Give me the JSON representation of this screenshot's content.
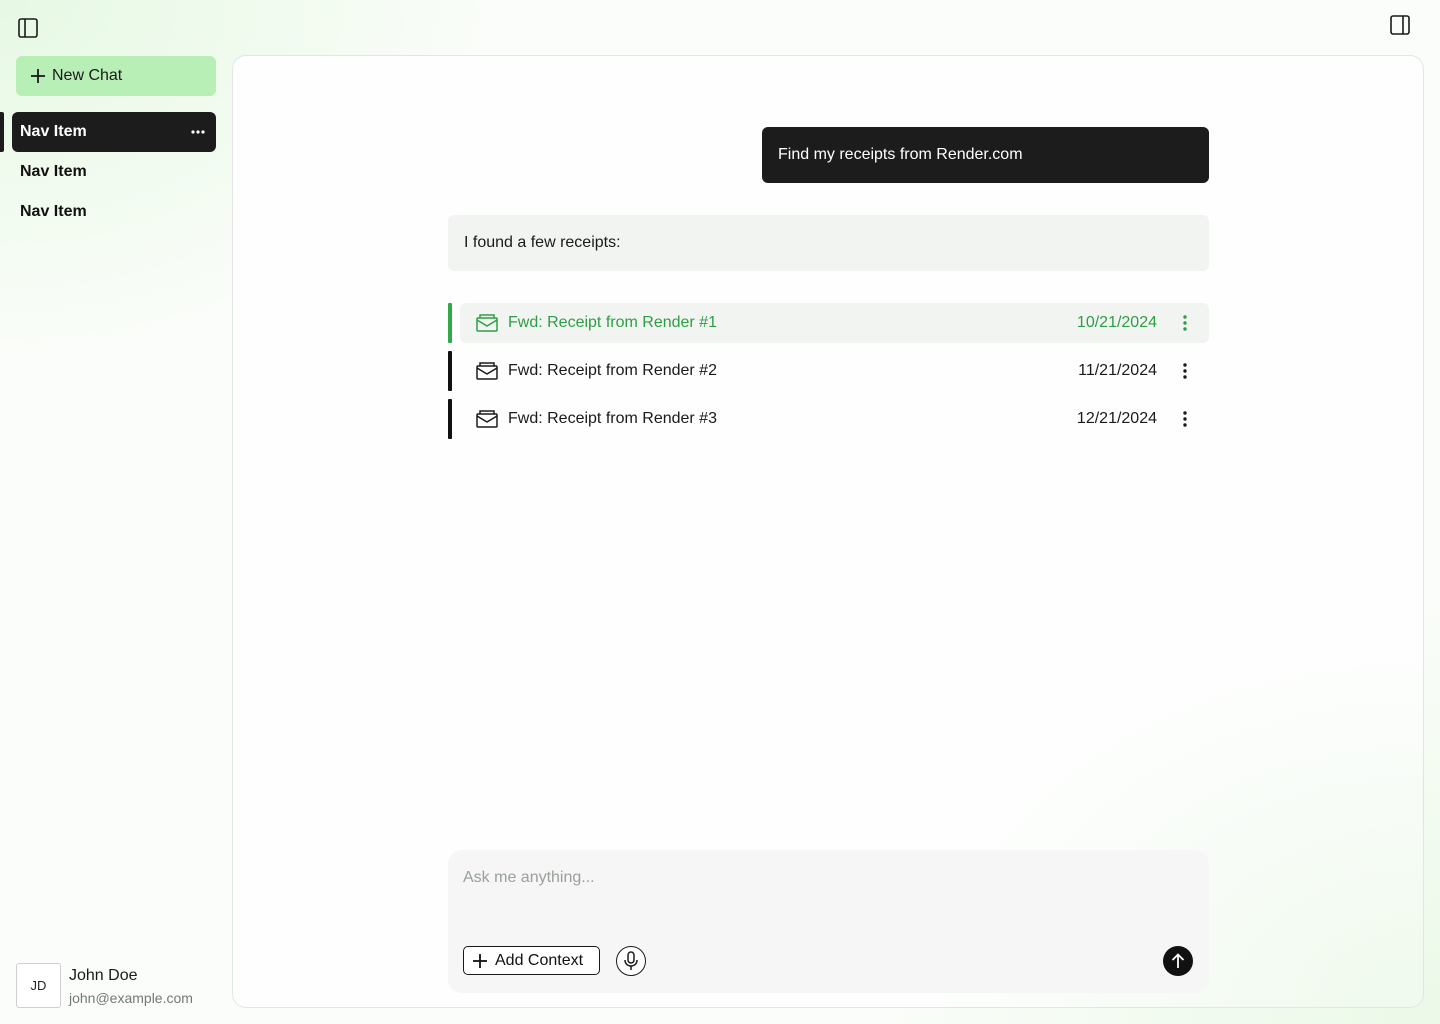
{
  "sidebar": {
    "new_chat_label": "New Chat",
    "items": [
      {
        "label": "Nav Item",
        "active": true
      },
      {
        "label": "Nav Item",
        "active": false
      },
      {
        "label": "Nav Item",
        "active": false
      }
    ],
    "user": {
      "initials": "JD",
      "name": "John Doe",
      "email": "john@example.com"
    }
  },
  "chat": {
    "user_message": "Find my receipts from Render.com",
    "assistant_message": "I found a few receipts:",
    "receipts": [
      {
        "title": "Fwd: Receipt from Render #1",
        "date": "10/21/2024",
        "selected": true
      },
      {
        "title": "Fwd: Receipt from Render #2",
        "date": "11/21/2024",
        "selected": false
      },
      {
        "title": "Fwd: Receipt from Render #3",
        "date": "12/21/2024",
        "selected": false
      }
    ]
  },
  "composer": {
    "placeholder": "Ask me anything...",
    "add_context_label": "Add Context"
  },
  "icons": {
    "left_toggle": "sidebar-left-icon",
    "right_toggle": "sidebar-right-icon",
    "mail": "mail-icon",
    "more": "more-vertical-icon",
    "mic": "microphone-icon",
    "send": "arrow-up-icon"
  },
  "colors": {
    "accent_green": "#2e9e45",
    "new_chat_bg": "#b8efb6",
    "dark": "#1c1c1c"
  }
}
